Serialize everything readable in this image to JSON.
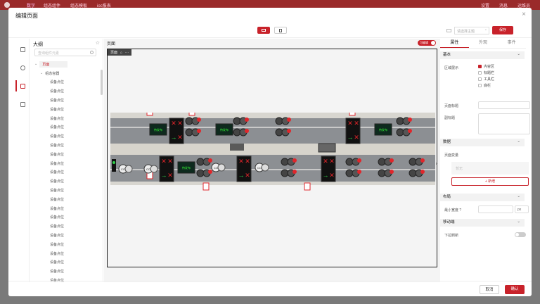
{
  "app": {
    "name": "数字",
    "nav": [
      "组态组件",
      "组态模板",
      "ioc报表"
    ],
    "right": [
      "设置",
      "消息",
      "运维员"
    ]
  },
  "dialog": {
    "title": "编辑页面",
    "close": "×",
    "theme_placeholder": "请选择主题",
    "save_label": "保存",
    "cancel_label": "取消",
    "ok_label": "确认"
  },
  "outline": {
    "title": "大纲",
    "search_placeholder": "查询组件元素",
    "root": "页面",
    "group": "组态容器",
    "items": [
      "设备点位",
      "设备点位",
      "设备点位",
      "设备点位",
      "设备点位",
      "设备点位",
      "设备点位",
      "设备点位",
      "设备点位",
      "设备点位",
      "设备点位",
      "设备点位",
      "设备点位",
      "设备点位",
      "设备点位",
      "设备点位",
      "设备点位",
      "设备点位",
      "设备点位",
      "设备点位",
      "设备点位",
      "设备点位",
      "设备点位",
      "设备点位"
    ]
  },
  "canvas": {
    "label": "页面",
    "edit_toggle": "可编辑",
    "crumb": "页面",
    "crumb_more": "···",
    "sign_text": "待发布"
  },
  "props": {
    "tabs": [
      "属性",
      "外观",
      "事件"
    ],
    "basic": "基本",
    "area_show": "区域展示",
    "areas": [
      "内容区",
      "标题栏",
      "工具栏",
      "底栏"
    ],
    "page_title": "页面标题",
    "subtitle": "副标题",
    "data": "数据",
    "page_var": "页面变量",
    "empty": "暂无",
    "add": "+ 新增",
    "layout": "布局",
    "min_width": "最小宽度",
    "unit": "px",
    "mobile": "移动端",
    "pull_refresh": "下拉刷新"
  },
  "colors": {
    "accent": "#c8222a",
    "sign_bg": "#0e2a1e",
    "arrow": "#2fd04a",
    "cross": "#e0262b"
  }
}
